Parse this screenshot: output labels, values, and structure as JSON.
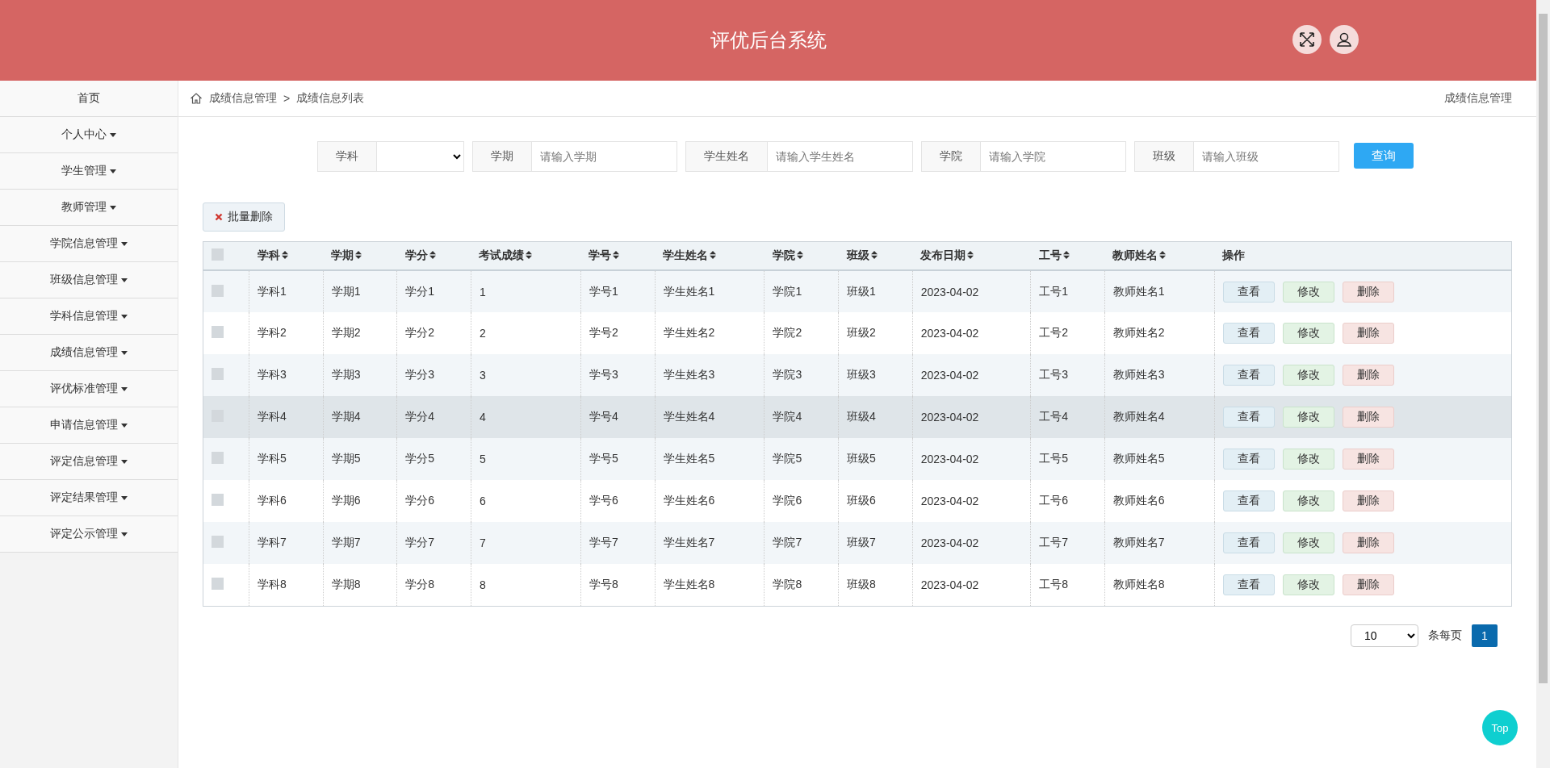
{
  "header": {
    "title": "评优后台系统"
  },
  "sidebar": {
    "items": [
      {
        "label": "首页",
        "has_menu": false
      },
      {
        "label": "个人中心",
        "has_menu": true
      },
      {
        "label": "学生管理",
        "has_menu": true
      },
      {
        "label": "教师管理",
        "has_menu": true
      },
      {
        "label": "学院信息管理",
        "has_menu": true
      },
      {
        "label": "班级信息管理",
        "has_menu": true
      },
      {
        "label": "学科信息管理",
        "has_menu": true
      },
      {
        "label": "成绩信息管理",
        "has_menu": true
      },
      {
        "label": "评优标准管理",
        "has_menu": true
      },
      {
        "label": "申请信息管理",
        "has_menu": true
      },
      {
        "label": "评定信息管理",
        "has_menu": true
      },
      {
        "label": "评定结果管理",
        "has_menu": true
      },
      {
        "label": "评定公示管理",
        "has_menu": true
      }
    ]
  },
  "breadcrumb": {
    "items": [
      "成绩信息管理",
      "成绩信息列表"
    ],
    "separator": ">",
    "page_title": "成绩信息管理"
  },
  "filters": [
    {
      "label": "学科",
      "kind": "select"
    },
    {
      "label": "学期",
      "kind": "text",
      "placeholder": "请输入学期"
    },
    {
      "label": "学生姓名",
      "kind": "text",
      "placeholder": "请输入学生姓名"
    },
    {
      "label": "学院",
      "kind": "text",
      "placeholder": "请输入学院"
    },
    {
      "label": "班级",
      "kind": "text",
      "placeholder": "请输入班级"
    }
  ],
  "search_button": "查询",
  "batch_delete_button": "批量删除",
  "table": {
    "header_checked": false,
    "columns": [
      {
        "label": "学科",
        "sortable": true
      },
      {
        "label": "学期",
        "sortable": true
      },
      {
        "label": "学分",
        "sortable": true
      },
      {
        "label": "考试成绩",
        "sortable": true
      },
      {
        "label": "学号",
        "sortable": true
      },
      {
        "label": "学生姓名",
        "sortable": true
      },
      {
        "label": "学院",
        "sortable": true
      },
      {
        "label": "班级",
        "sortable": true
      },
      {
        "label": "发布日期",
        "sortable": true
      },
      {
        "label": "工号",
        "sortable": true
      },
      {
        "label": "教师姓名",
        "sortable": true
      },
      {
        "label": "操作",
        "sortable": false
      }
    ],
    "rows": [
      {
        "checked": false,
        "hovered": false,
        "actions": [
          {
            "label": "查看",
            "kind": "view"
          },
          {
            "label": "修改",
            "kind": "edit"
          },
          {
            "label": "删除",
            "kind": "delete"
          }
        ],
        "cells": [
          "学科1",
          "学期1",
          "学分1",
          "1",
          "学号1",
          "学生姓名1",
          "学院1",
          "班级1",
          "2023-04-02",
          "工号1",
          "教师姓名1"
        ]
      },
      {
        "checked": false,
        "hovered": false,
        "actions": [
          {
            "label": "查看",
            "kind": "view"
          },
          {
            "label": "修改",
            "kind": "edit"
          },
          {
            "label": "删除",
            "kind": "delete"
          }
        ],
        "cells": [
          "学科2",
          "学期2",
          "学分2",
          "2",
          "学号2",
          "学生姓名2",
          "学院2",
          "班级2",
          "2023-04-02",
          "工号2",
          "教师姓名2"
        ]
      },
      {
        "checked": false,
        "hovered": false,
        "actions": [
          {
            "label": "查看",
            "kind": "view"
          },
          {
            "label": "修改",
            "kind": "edit"
          },
          {
            "label": "删除",
            "kind": "delete"
          }
        ],
        "cells": [
          "学科3",
          "学期3",
          "学分3",
          "3",
          "学号3",
          "学生姓名3",
          "学院3",
          "班级3",
          "2023-04-02",
          "工号3",
          "教师姓名3"
        ]
      },
      {
        "checked": false,
        "hovered": true,
        "actions": [
          {
            "label": "查看",
            "kind": "view"
          },
          {
            "label": "修改",
            "kind": "edit"
          },
          {
            "label": "删除",
            "kind": "delete"
          }
        ],
        "cells": [
          "学科4",
          "学期4",
          "学分4",
          "4",
          "学号4",
          "学生姓名4",
          "学院4",
          "班级4",
          "2023-04-02",
          "工号4",
          "教师姓名4"
        ]
      },
      {
        "checked": false,
        "hovered": false,
        "actions": [
          {
            "label": "查看",
            "kind": "view"
          },
          {
            "label": "修改",
            "kind": "edit"
          },
          {
            "label": "删除",
            "kind": "delete"
          }
        ],
        "cells": [
          "学科5",
          "学期5",
          "学分5",
          "5",
          "学号5",
          "学生姓名5",
          "学院5",
          "班级5",
          "2023-04-02",
          "工号5",
          "教师姓名5"
        ]
      },
      {
        "checked": false,
        "hovered": false,
        "actions": [
          {
            "label": "查看",
            "kind": "view"
          },
          {
            "label": "修改",
            "kind": "edit"
          },
          {
            "label": "删除",
            "kind": "delete"
          }
        ],
        "cells": [
          "学科6",
          "学期6",
          "学分6",
          "6",
          "学号6",
          "学生姓名6",
          "学院6",
          "班级6",
          "2023-04-02",
          "工号6",
          "教师姓名6"
        ]
      },
      {
        "checked": false,
        "hovered": false,
        "actions": [
          {
            "label": "查看",
            "kind": "view"
          },
          {
            "label": "修改",
            "kind": "edit"
          },
          {
            "label": "删除",
            "kind": "delete"
          }
        ],
        "cells": [
          "学科7",
          "学期7",
          "学分7",
          "7",
          "学号7",
          "学生姓名7",
          "学院7",
          "班级7",
          "2023-04-02",
          "工号7",
          "教师姓名7"
        ]
      },
      {
        "checked": false,
        "hovered": false,
        "actions": [
          {
            "label": "查看",
            "kind": "view"
          },
          {
            "label": "修改",
            "kind": "edit"
          },
          {
            "label": "删除",
            "kind": "delete"
          }
        ],
        "cells": [
          "学科8",
          "学期8",
          "学分8",
          "8",
          "学号8",
          "学生姓名8",
          "学院8",
          "班级8",
          "2023-04-02",
          "工号8",
          "教师姓名8"
        ]
      }
    ]
  },
  "pagination": {
    "page_size": "10",
    "page_size_label": "条每页",
    "pages": [
      {
        "label": "1",
        "selected": true
      }
    ]
  },
  "top_button": "Top"
}
